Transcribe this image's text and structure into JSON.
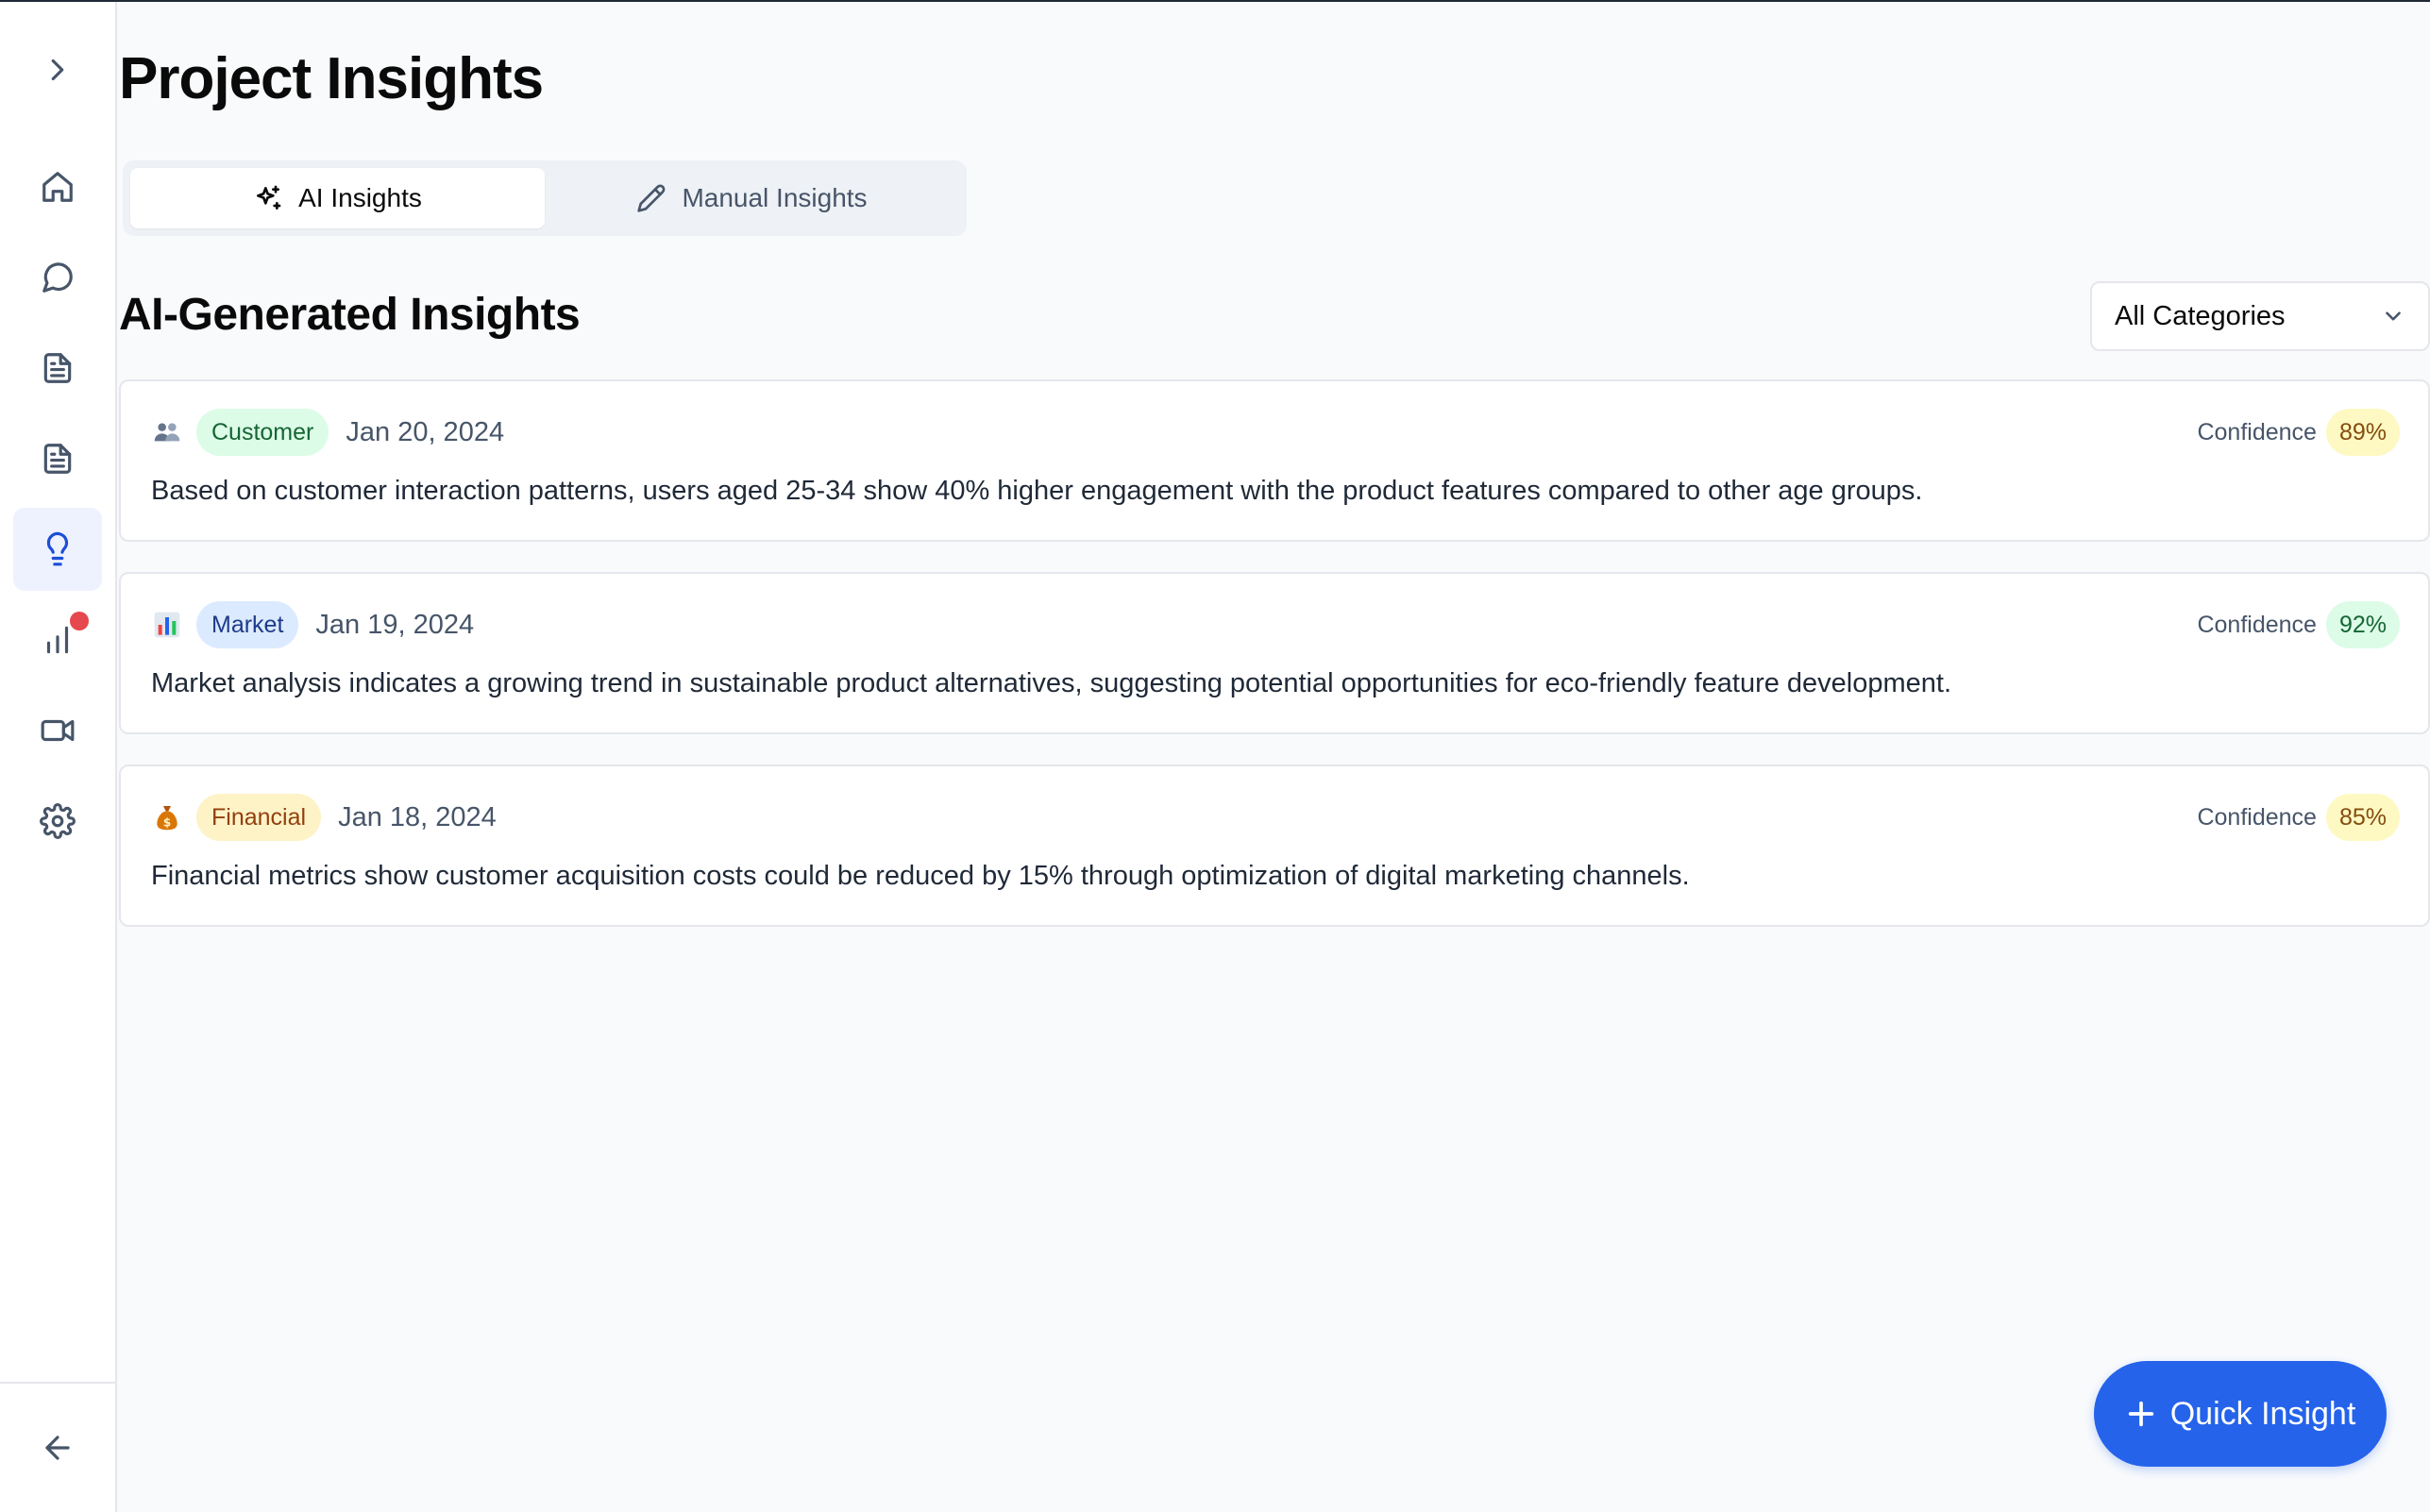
{
  "page": {
    "title": "Project Insights"
  },
  "tabs": [
    {
      "label": "AI Insights",
      "icon": "sparkles-icon",
      "active": true
    },
    {
      "label": "Manual Insights",
      "icon": "pencil-icon",
      "active": false
    }
  ],
  "section": {
    "title": "AI-Generated Insights"
  },
  "filter": {
    "selected": "All Categories",
    "icon": "chevron-down-icon"
  },
  "sidebar": {
    "items": [
      {
        "icon": "chevron-right-icon"
      },
      {
        "icon": "home-icon"
      },
      {
        "icon": "chat-bubble-icon"
      },
      {
        "icon": "document-icon"
      },
      {
        "icon": "document-icon"
      },
      {
        "icon": "lightbulb-icon",
        "active": true
      },
      {
        "icon": "bar-chart-icon",
        "notification": true
      },
      {
        "icon": "video-camera-icon"
      },
      {
        "icon": "gear-icon"
      },
      {
        "icon": "arrow-left-icon"
      }
    ],
    "notification_color": "#e5484d"
  },
  "insights": [
    {
      "emoji": "👥",
      "category": "Customer",
      "date": "Jan 20, 2024",
      "confidence_label": "Confidence",
      "confidence": "89%",
      "text": "Based on customer interaction patterns, users aged 25-34 show 40% higher engagement with the product features compared to other age groups."
    },
    {
      "emoji": "📊",
      "category": "Market",
      "date": "Jan 19, 2024",
      "confidence_label": "Confidence",
      "confidence": "92%",
      "text": "Market analysis indicates a growing trend in sustainable product alternatives, suggesting potential opportunities for eco-friendly feature development."
    },
    {
      "emoji": "💰",
      "category": "Financial",
      "date": "Jan 18, 2024",
      "confidence_label": "Confidence",
      "confidence": "85%",
      "text": "Financial metrics show customer acquisition costs could be reduced by 15% through optimization of digital marketing channels."
    }
  ],
  "fab": {
    "label": "Quick Insight",
    "icon": "plus-icon"
  },
  "colors": {
    "accent": "#2563eb",
    "background": "#f8fafc",
    "customer_badge": "#dcfce7",
    "market_badge": "#dbeafe",
    "financial_badge": "#fef3c7"
  }
}
